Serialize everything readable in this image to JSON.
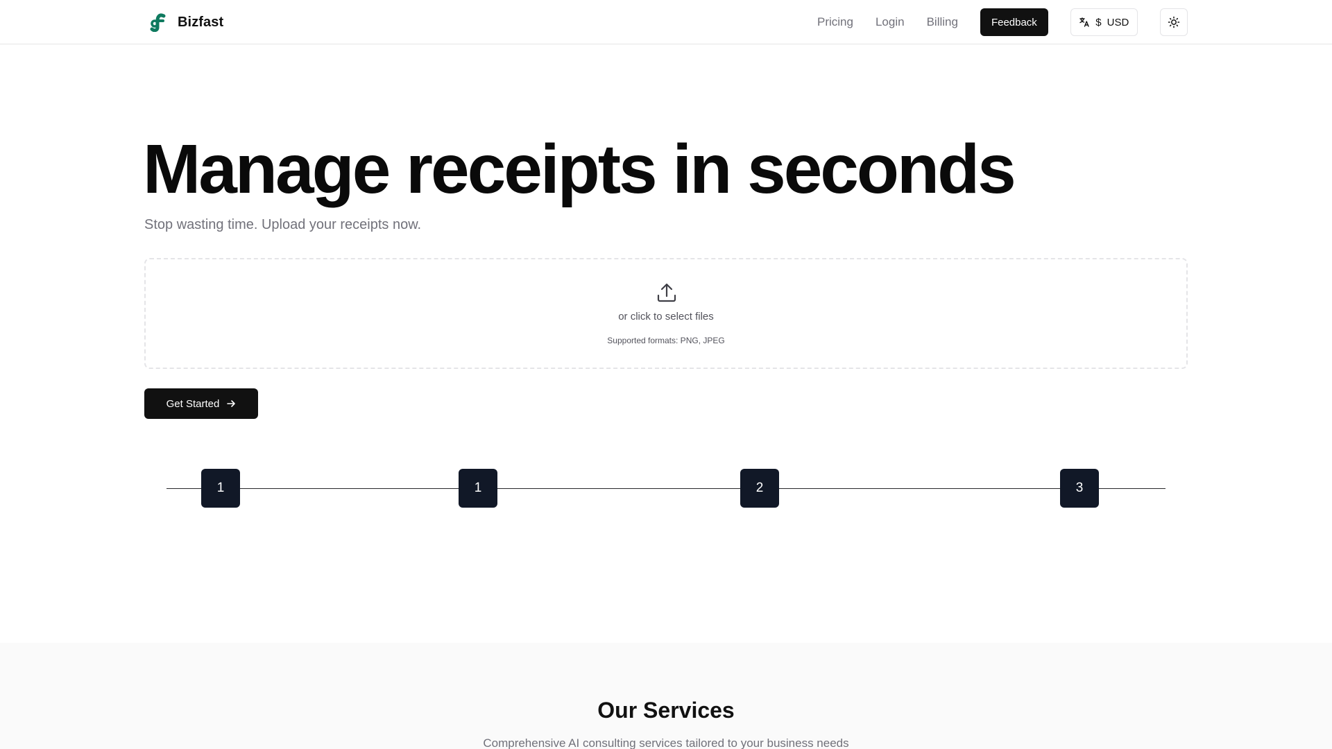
{
  "header": {
    "brand_name": "Bizfast",
    "nav": {
      "pricing": "Pricing",
      "login": "Login",
      "billing": "Billing",
      "feedback": "Feedback"
    },
    "locale": {
      "currency_symbol": "$",
      "currency_code": "USD"
    },
    "icons": {
      "logo": "bizfast-logo",
      "locale": "translate-icon",
      "theme": "sun-icon"
    }
  },
  "hero": {
    "title": "Manage receipts in seconds",
    "subtitle": "Stop wasting time. Upload your receipts now."
  },
  "dropzone": {
    "icon": "upload-icon",
    "text": "or click to select files",
    "formats": "Supported formats: PNG, JPEG"
  },
  "cta": {
    "label": "Get Started",
    "icon": "arrow-right-icon"
  },
  "steps": [
    "1",
    "1",
    "2",
    "3"
  ],
  "services": {
    "title": "Our Services",
    "subtitle": "Comprehensive AI consulting services tailored to your business needs"
  },
  "colors": {
    "brand_logo": "#0f7a5f",
    "primary": "#111111",
    "step_bg": "#111827",
    "muted_text": "#71717a",
    "border": "#e4e4e7",
    "section_bg": "#fafafa"
  }
}
